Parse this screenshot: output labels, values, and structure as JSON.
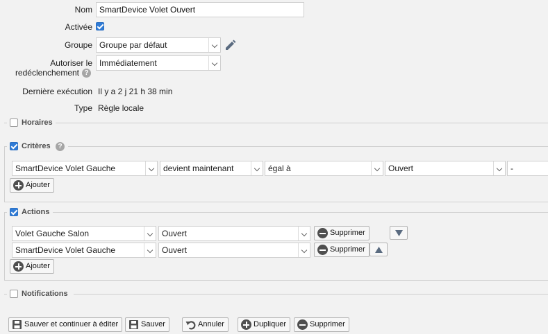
{
  "rule": {
    "name_label": "Nom",
    "name_value": "SmartDevice Volet Ouvert",
    "enabled_label": "Activée",
    "enabled": true,
    "group_label": "Groupe",
    "group_value": "Groupe par défaut",
    "retrigger_label_1": "Autoriser le",
    "retrigger_label_2": "redéclenchement",
    "retrigger_value": "Immédiatement",
    "last_exec_label": "Dernière exécution",
    "last_exec_value": "Il y a 2 j 21 h 38 min",
    "type_label": "Type",
    "type_value": "Règle locale"
  },
  "schedules": {
    "legend": "Horaires",
    "checked": false
  },
  "criteria": {
    "legend": "Critères",
    "checked": true,
    "rows": [
      {
        "device": "SmartDevice Volet Gauche",
        "change": "devient maintenant",
        "operator": "égal à",
        "value": "Ouvert",
        "extra": "-"
      }
    ],
    "add_label": "Ajouter"
  },
  "actions": {
    "legend": "Actions",
    "checked": true,
    "rows": [
      {
        "device": "Volet Gauche Salon",
        "value": "Ouvert",
        "delete_label": "Supprimer"
      },
      {
        "device": "SmartDevice Volet Gauche",
        "value": "Ouvert",
        "delete_label": "Supprimer"
      }
    ],
    "add_label": "Ajouter"
  },
  "notifications": {
    "legend": "Notifications",
    "checked": false
  },
  "footer": {
    "save_continue": "Sauver et continuer à éditer",
    "save": "Sauver",
    "cancel": "Annuler",
    "duplicate": "Dupliquer",
    "delete": "Supprimer"
  },
  "colors": {
    "checkbox_blue": "#2f7bd6",
    "background": "#f2f2f2"
  }
}
